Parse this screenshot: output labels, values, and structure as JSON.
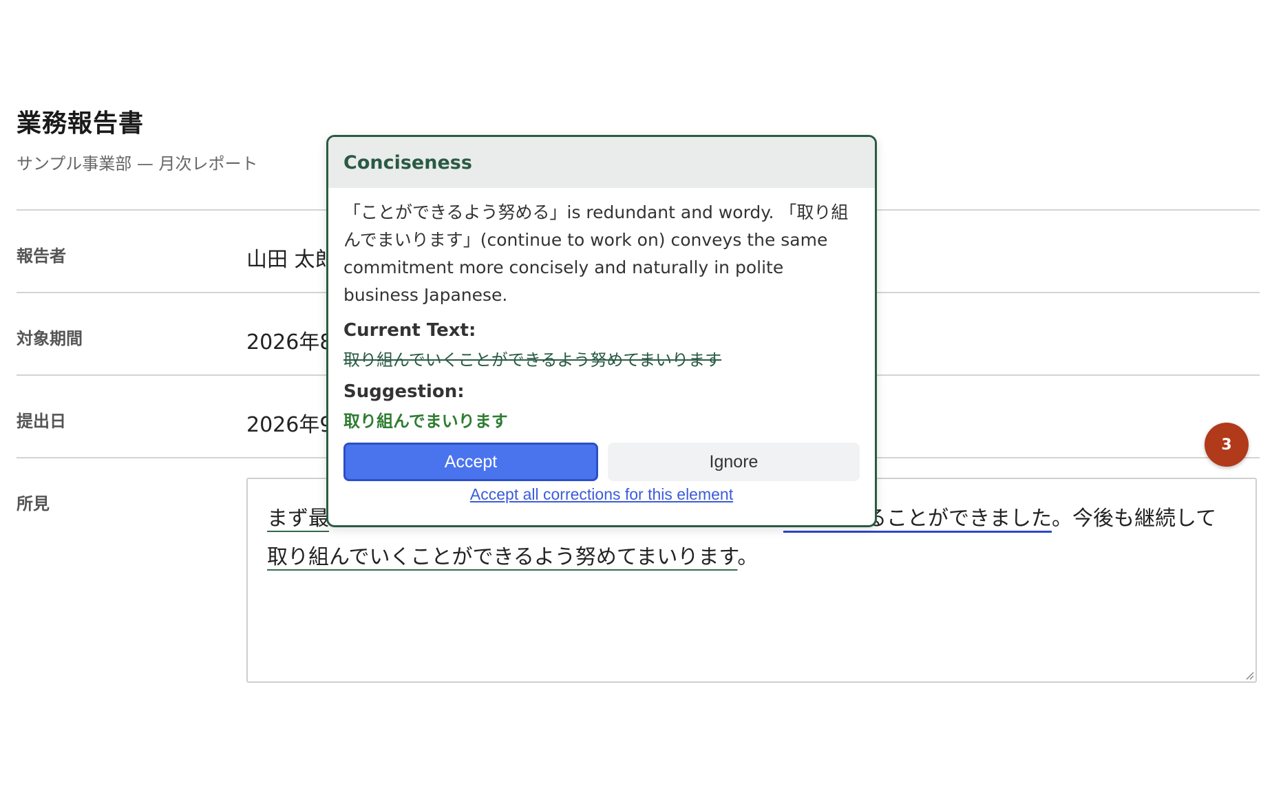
{
  "document": {
    "title": "業務報告書",
    "subtitle": "サンプル事業部 — 月次レポート"
  },
  "fields": [
    {
      "label": "報告者",
      "value": "山田 太郎"
    },
    {
      "label": "対象期間",
      "value": "2026年8"
    },
    {
      "label": "提出日",
      "value": "2026年9"
    }
  ],
  "remarks": {
    "label": "所見",
    "seg1": "まず最",
    "seg2": "が増加することができました",
    "seg3": "。今後も継続して",
    "seg4": "取り組んでいくことができるよう努めてまいります",
    "seg5": "。"
  },
  "badge": {
    "count": "3",
    "color": "#b03a1a"
  },
  "popover": {
    "title": "Conciseness",
    "explanation": "「ことができるよう努める」is redundant and wordy. 「取り組んでまいります」(continue to work on) conveys the same commitment more concisely and naturally in polite business Japanese.",
    "current_label": "Current Text:",
    "current_text": "取り組んでいくことができるよう努めてまいります",
    "suggestion_label": "Suggestion:",
    "suggestion_text": "取り組んでまいります",
    "accept_label": "Accept",
    "ignore_label": "Ignore",
    "accept_all_label": "Accept all corrections for this element",
    "accent_color": "#2a5a44",
    "accept_color": "#4a74ee"
  }
}
